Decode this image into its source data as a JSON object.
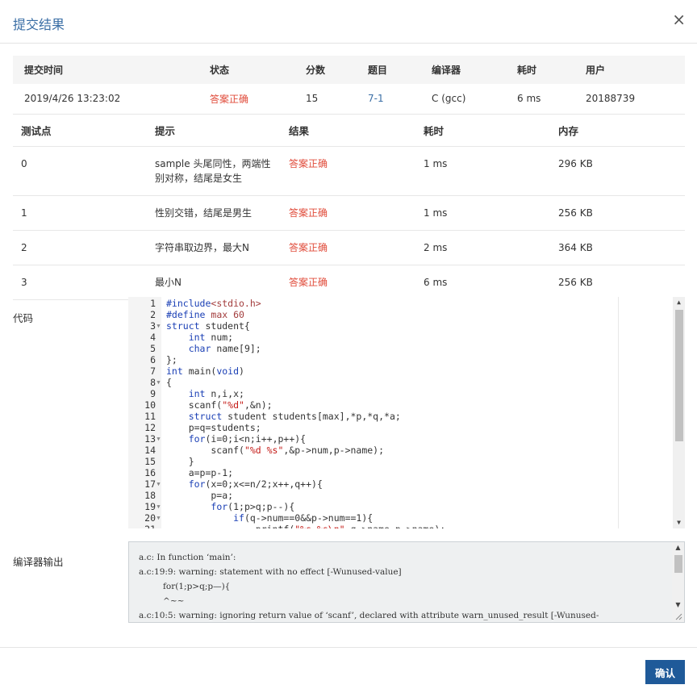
{
  "dialog": {
    "title": "提交结果",
    "close_glyph": "×",
    "confirm_label": "确认"
  },
  "summary": {
    "headers": [
      "提交时间",
      "状态",
      "分数",
      "题目",
      "编译器",
      "耗时",
      "用户"
    ],
    "row": [
      "2019/4/26 13:23:02",
      "答案正确",
      "15",
      "7-1",
      "C (gcc)",
      "6 ms",
      "20188739"
    ]
  },
  "tests": {
    "headers": [
      "测试点",
      "提示",
      "结果",
      "耗时",
      "内存"
    ],
    "rows": [
      [
        "0",
        "sample 头尾同性，两端性别对称，结尾是女生",
        "答案正确",
        "1 ms",
        "296 KB"
      ],
      [
        "1",
        "性别交错，结尾是男生",
        "答案正确",
        "1 ms",
        "256 KB"
      ],
      [
        "2",
        "字符串取边界，最大N",
        "答案正确",
        "2 ms",
        "364 KB"
      ],
      [
        "3",
        "最小N",
        "答案正确",
        "6 ms",
        "256 KB"
      ]
    ]
  },
  "code_label": "代码",
  "code_lines": [
    "#include<stdio.h>",
    "#define max 60",
    "struct student{",
    "    int num;",
    "    char name[9];",
    "};",
    "int main(void)",
    "{",
    "    int n,i,x;",
    "    scanf(\"%d\",&n);",
    "    struct student students[max],*p,*q,*a;",
    "    p=q=students;",
    "    for(i=0;i<n;i++,p++){",
    "        scanf(\"%d %s\",&p->num,p->name);",
    "    }",
    "    a=p=p-1;",
    "    for(x=0;x<=n/2;x++,q++){",
    "        p=a;",
    "        for(1;p>q;p--){",
    "            if(q->num==0&&p->num==1){",
    "                printf(\"%s %s\\n\",q->name,p->name);"
  ],
  "compiler_label": "编译器输出",
  "compiler_output": [
    "a.c: In function ‘main’:",
    "a.c:19:9: warning: statement with no effect [-Wunused-value]",
    "         for(1;p>q;p—){",
    "         ^~~",
    "a.c:10:5: warning: ignoring return value of ‘scanf’, declared with attribute warn_unused_result [-Wunused-"
  ]
}
